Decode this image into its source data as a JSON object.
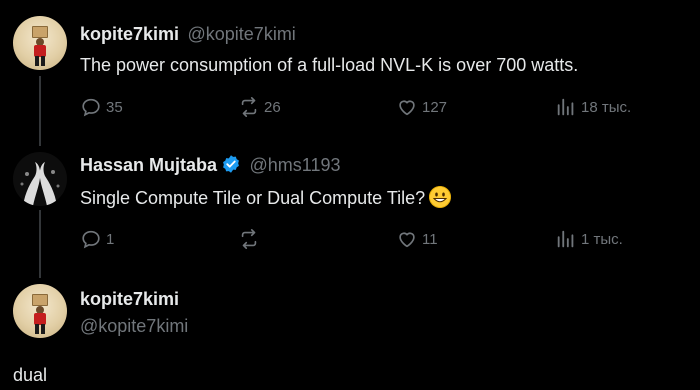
{
  "tweets": [
    {
      "name": "kopite7kimi",
      "handle": "@kopite7kimi",
      "text": "The power consumption of a full-load NVL-K is over 700 watts.",
      "replies": "35",
      "retweets": "26",
      "likes": "127",
      "views": "18 тыс."
    },
    {
      "name": "Hassan Mujtaba",
      "handle": "@hms1193",
      "text": "Single Compute Tile or Dual Compute Tile?",
      "emoji": "grinning-face",
      "verified": true,
      "replies": "1",
      "retweets": "",
      "likes": "11",
      "views": "1 тыс."
    },
    {
      "name": "kopite7kimi",
      "handle": "@kopite7kimi",
      "text": "dual"
    }
  ],
  "colors": {
    "background": "#000000",
    "text": "#e7e9ea",
    "muted": "#71767b",
    "verified": "#1d9bf0",
    "thread_line": "#333639"
  },
  "icons": [
    "reply-icon",
    "retweet-icon",
    "like-icon",
    "views-icon",
    "verified-badge-icon"
  ]
}
